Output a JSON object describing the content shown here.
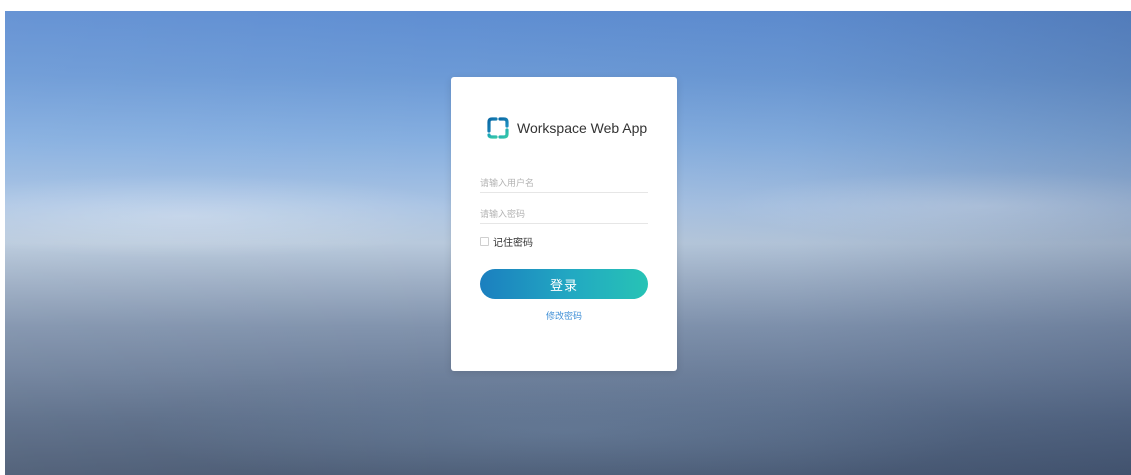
{
  "app": {
    "title": "Workspace Web App",
    "logo_icon": "workspace-bracket-logo-icon"
  },
  "form": {
    "username_placeholder": "请输入用户名",
    "password_placeholder": "请输入密码",
    "username_value": "",
    "password_value": "",
    "remember_label": "记住密码",
    "remember_checked": false,
    "login_label": "登录",
    "change_password_label": "修改密码"
  },
  "colors": {
    "button_gradient_start": "#1b7fbf",
    "button_gradient_end": "#27c3b5",
    "link": "#3f8fd6",
    "logo_dark": "#0b6aa5",
    "logo_light": "#35c6a8"
  }
}
